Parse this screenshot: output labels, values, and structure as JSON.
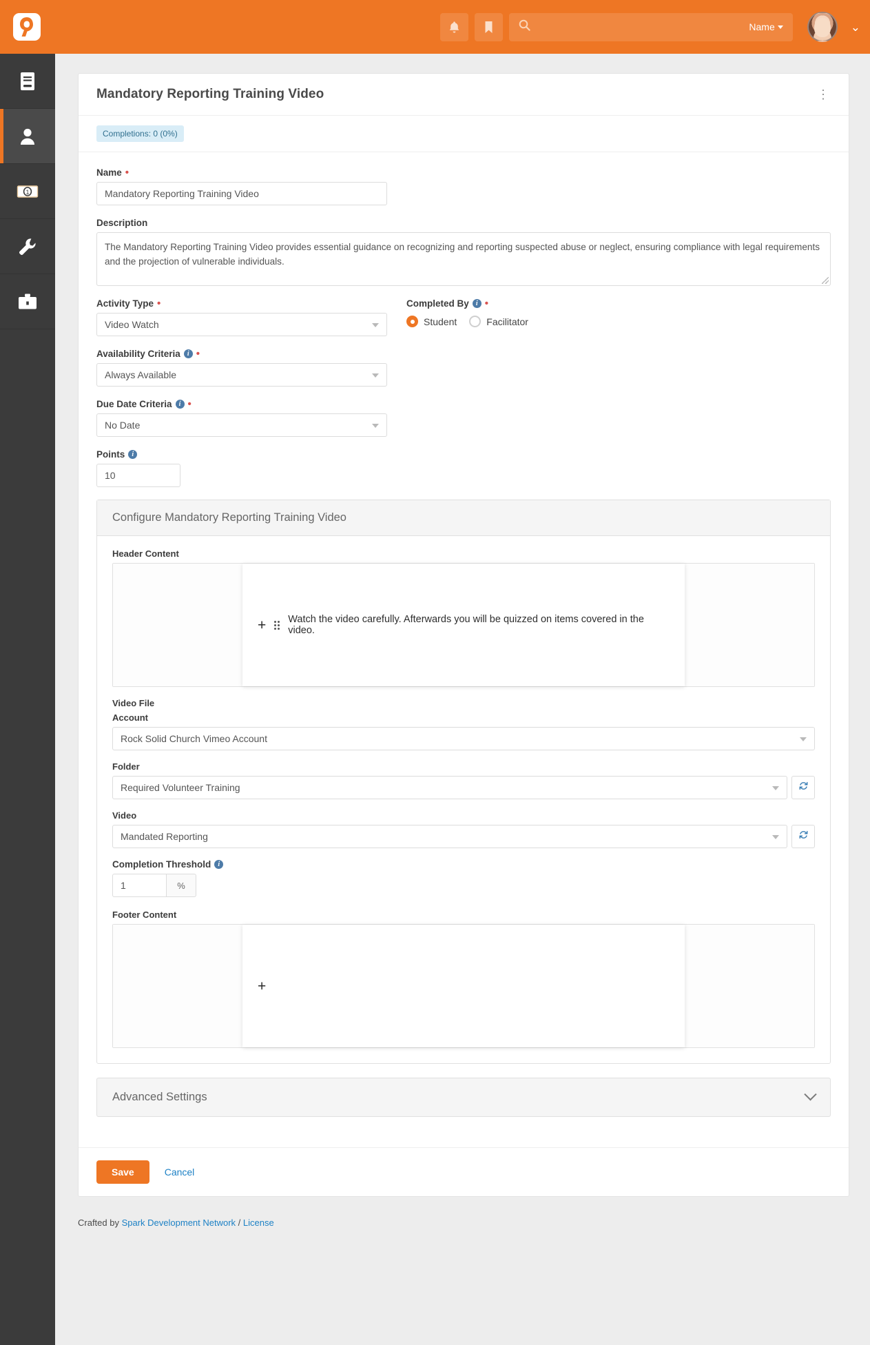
{
  "topbar": {
    "logo_name": "rock-logo",
    "notification_icon": "bell-icon",
    "bookmark_icon": "bookmark-icon",
    "search_icon": "search-icon",
    "search_value": "",
    "search_placeholder": "",
    "search_scope": "Name",
    "avatar_name": "user-avatar",
    "brand_color": "#ee7624"
  },
  "sidebar": {
    "items": [
      {
        "icon": "book-icon",
        "name": "sidebar-item-cms",
        "active": false
      },
      {
        "icon": "person-icon",
        "name": "sidebar-item-people",
        "active": true
      },
      {
        "icon": "money-icon",
        "name": "sidebar-item-finance",
        "active": false
      },
      {
        "icon": "wrench-icon",
        "name": "sidebar-item-admin",
        "active": false
      },
      {
        "icon": "briefcase-icon",
        "name": "sidebar-item-tools",
        "active": false
      }
    ]
  },
  "panel": {
    "title": "Mandatory Reporting Training Video",
    "kebab": "⋮",
    "completions_badge": "Completions: 0 (0%)"
  },
  "form": {
    "name": {
      "label": "Name",
      "required": true,
      "value": "Mandatory Reporting Training Video"
    },
    "description": {
      "label": "Description",
      "value": "The Mandatory Reporting Training Video provides essential guidance on recognizing and reporting suspected abuse or neglect, ensuring compliance with legal requirements and the projection of vulnerable individuals."
    },
    "activity_type": {
      "label": "Activity Type",
      "required": true,
      "value": "Video Watch"
    },
    "completed_by": {
      "label": "Completed By",
      "required": true,
      "has_info": true,
      "options": [
        {
          "label": "Student",
          "selected": true
        },
        {
          "label": "Facilitator",
          "selected": false
        }
      ]
    },
    "availability_criteria": {
      "label": "Availability Criteria",
      "required": true,
      "has_info": true,
      "value": "Always Available"
    },
    "due_date_criteria": {
      "label": "Due Date Criteria",
      "required": true,
      "has_info": true,
      "value": "No Date"
    },
    "points": {
      "label": "Points",
      "has_info": true,
      "value": "10"
    }
  },
  "configure": {
    "title": "Configure Mandatory Reporting Training Video",
    "header_content": {
      "label": "Header Content",
      "text": "Watch the video carefully.  Afterwards you will be quizzed on items covered in the video.",
      "add_icon": "plus-icon",
      "drag_icon": "drag-handle-icon"
    },
    "video_file": {
      "label": "Video File"
    },
    "account": {
      "label": "Account",
      "value": "Rock Solid Church Vimeo Account"
    },
    "folder": {
      "label": "Folder",
      "value": "Required Volunteer Training",
      "refresh_icon": "refresh-icon"
    },
    "video": {
      "label": "Video",
      "value": "Mandated Reporting",
      "refresh_icon": "refresh-icon"
    },
    "completion_threshold": {
      "label": "Completion Threshold",
      "has_info": true,
      "value": "1",
      "unit": "%"
    },
    "footer_content": {
      "label": "Footer Content",
      "text": "",
      "add_icon": "plus-icon"
    }
  },
  "advanced_settings": {
    "title": "Advanced Settings",
    "chevron": "chevron-down-icon"
  },
  "actions": {
    "save_label": "Save",
    "cancel_label": "Cancel"
  },
  "page_footer": {
    "prefix": "Crafted by ",
    "link1": "Spark Development Network",
    "separator": " / ",
    "link2": "License"
  }
}
